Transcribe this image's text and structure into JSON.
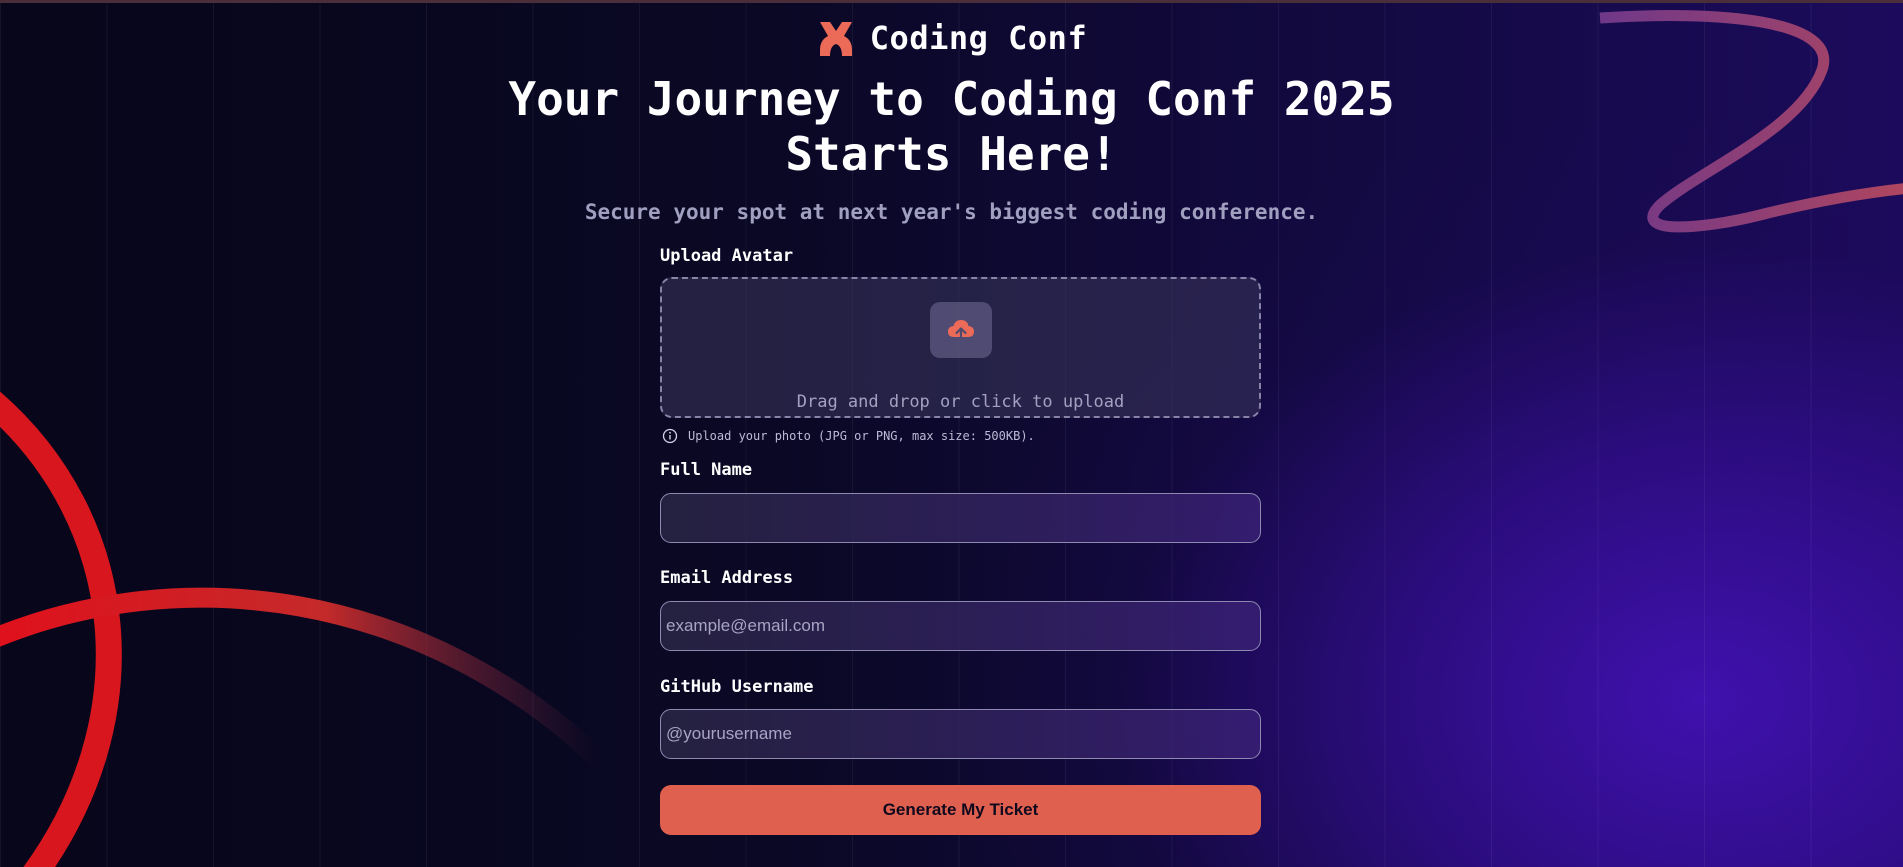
{
  "brand": {
    "name": "Coding Conf",
    "accent": "#e0604f"
  },
  "hero": {
    "title_line1": "Your Journey to Coding Conf 2025",
    "title_line2": "Starts Here!",
    "subtitle": "Secure your spot at next year's biggest coding conference."
  },
  "form": {
    "avatar": {
      "label": "Upload Avatar",
      "drop_text": "Drag and drop or click to upload",
      "hint": "Upload your photo (JPG or PNG, max size: 500KB).",
      "icon": "cloud-upload-icon"
    },
    "full_name": {
      "label": "Full Name",
      "value": "",
      "placeholder": ""
    },
    "email": {
      "label": "Email Address",
      "value": "",
      "placeholder": "example@email.com"
    },
    "github": {
      "label": "GitHub Username",
      "value": "",
      "placeholder": "@yourusername"
    },
    "submit_label": "Generate My Ticket"
  }
}
